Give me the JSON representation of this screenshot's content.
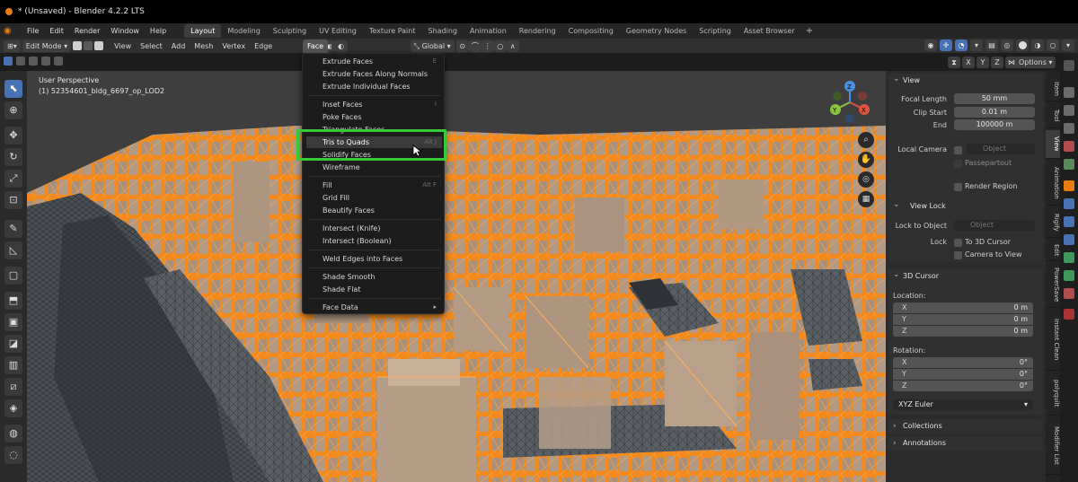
{
  "title_bar": {
    "title": "* (Unsaved) - Blender 4.2.2 LTS"
  },
  "menu_bar": {
    "items": [
      "File",
      "Edit",
      "Render",
      "Window",
      "Help"
    ],
    "workspaces": [
      "Layout",
      "Modeling",
      "Sculpting",
      "UV Editing",
      "Texture Paint",
      "Shading",
      "Animation",
      "Rendering",
      "Compositing",
      "Geometry Nodes",
      "Scripting",
      "Asset Browser"
    ],
    "active_workspace": "Layout",
    "add_workspace": "+"
  },
  "header": {
    "mode": "Edit Mode",
    "menus": [
      "View",
      "Select",
      "Add",
      "Mesh",
      "Vertex",
      "Edge",
      "Face",
      "UV"
    ],
    "orientation": "Global",
    "options": "Options",
    "axes": [
      "X",
      "Y",
      "Z"
    ]
  },
  "viewport": {
    "view_name": "User Perspective",
    "object_name": "(1) 52354601_bldg_6697_op_LOD2",
    "gizmo": {
      "x": "X",
      "y": "Y",
      "z": "Z"
    },
    "accent": "#e87d0d"
  },
  "face_menu": {
    "title": "Face",
    "groups": [
      [
        {
          "label": "Extrude Faces",
          "shortcut": "E"
        },
        {
          "label": "Extrude Faces Along Normals",
          "shortcut": ""
        },
        {
          "label": "Extrude Individual Faces",
          "shortcut": ""
        }
      ],
      [
        {
          "label": "Inset Faces",
          "shortcut": "I"
        },
        {
          "label": "Poke Faces",
          "shortcut": ""
        },
        {
          "label": "Triangulate Faces",
          "shortcut": ""
        },
        {
          "label": "Tris to Quads",
          "shortcut": "Alt J"
        },
        {
          "label": "Solidify Faces",
          "shortcut": ""
        },
        {
          "label": "Wireframe",
          "shortcut": ""
        }
      ],
      [
        {
          "label": "Fill",
          "shortcut": "Alt F"
        },
        {
          "label": "Grid Fill",
          "shortcut": ""
        },
        {
          "label": "Beautify Faces",
          "shortcut": ""
        }
      ],
      [
        {
          "label": "Intersect (Knife)",
          "shortcut": ""
        },
        {
          "label": "Intersect (Boolean)",
          "shortcut": ""
        }
      ],
      [
        {
          "label": "Weld Edges into Faces",
          "shortcut": ""
        }
      ],
      [
        {
          "label": "Shade Smooth",
          "shortcut": ""
        },
        {
          "label": "Shade Flat",
          "shortcut": ""
        }
      ],
      [
        {
          "label": "Face Data",
          "shortcut": "▸"
        }
      ]
    ],
    "highlighted": "Tris to Quads",
    "highlight_color": "#39c83a"
  },
  "sidebar": {
    "view_panel": {
      "title": "View",
      "focal_length_label": "Focal Length",
      "focal_length": "50 mm",
      "clip_start_label": "Clip Start",
      "clip_start": "0.01 m",
      "end_label": "End",
      "end": "100000 m",
      "local_camera_label": "Local Camera",
      "local_camera_placeholder": "Object",
      "passepartout": "Passepartout",
      "render_region": "Render Region"
    },
    "view_lock_panel": {
      "title": "View Lock",
      "lock_to_object_label": "Lock to Object",
      "lock_to_object_placeholder": "Object",
      "lock_label": "Lock",
      "to_3d_cursor": "To 3D Cursor",
      "camera_to_view": "Camera to View"
    },
    "cursor_panel": {
      "title": "3D Cursor",
      "location_label": "Location:",
      "location": [
        {
          "axis": "X",
          "value": "0 m"
        },
        {
          "axis": "Y",
          "value": "0 m"
        },
        {
          "axis": "Z",
          "value": "0 m"
        }
      ],
      "rotation_label": "Rotation:",
      "rotation": [
        {
          "axis": "X",
          "value": "0°"
        },
        {
          "axis": "Y",
          "value": "0°"
        },
        {
          "axis": "Z",
          "value": "0°"
        }
      ],
      "rotation_mode": "XYZ Euler"
    },
    "collections": "Collections",
    "annotations": "Annotations"
  },
  "side_tabs": [
    "Item",
    "Tool",
    "View",
    "Animation",
    "Rigify",
    "Edit",
    "PowerSave",
    "Instant Clean",
    "polyquilt",
    "Modifier List"
  ],
  "active_side_tab": "View"
}
